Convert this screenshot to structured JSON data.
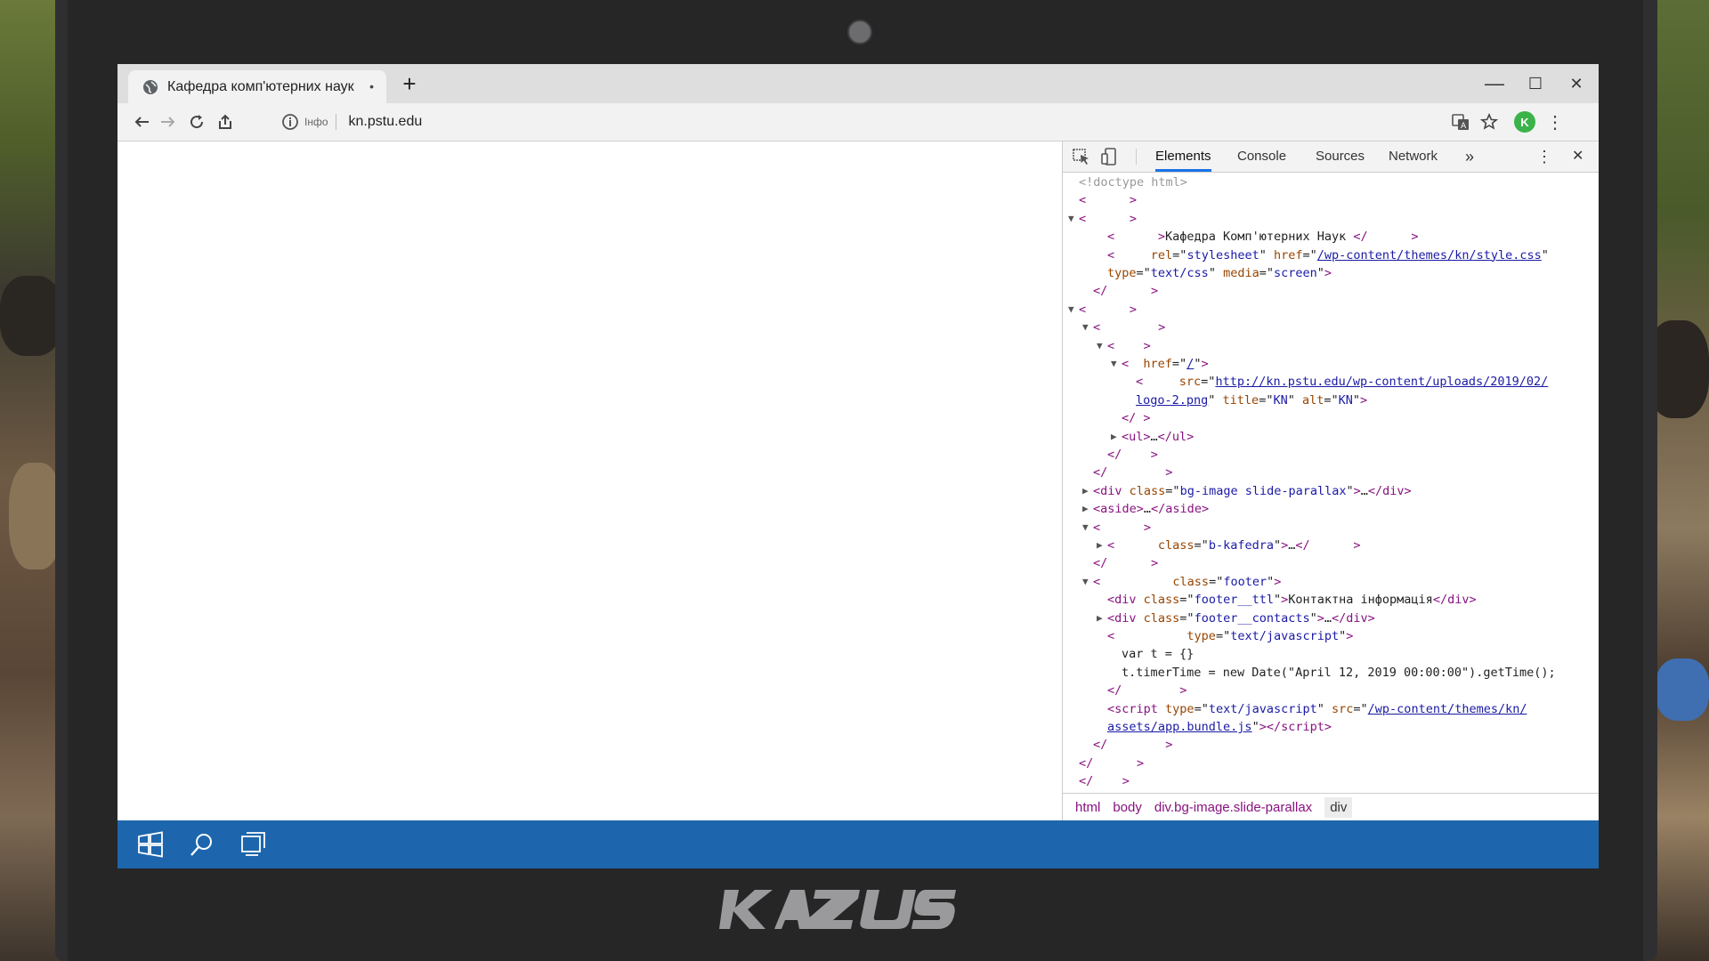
{
  "browser": {
    "tab_title": "Кафедра комп'ютерних наук",
    "tab_close": "•",
    "new_tab": "+",
    "url": "kn.pstu.edu",
    "security_label": "Інфо",
    "avatar_letter": "K",
    "accent_color": "#1a73e8"
  },
  "window_controls": {
    "minimize": "—",
    "maximize": "☐",
    "close": "✕"
  },
  "devtools": {
    "tabs": [
      "Elements",
      "Console",
      "Sources",
      "Network"
    ],
    "overflow": "»",
    "menu": "⋮",
    "close": "✕",
    "lines": [
      {
        "indent": 0,
        "tri": "",
        "html": "<span class='doctype'>&lt;!doctype html&gt;</span>"
      },
      {
        "indent": 0,
        "tri": "",
        "html": "<span class='tag'>&lt;      &gt;</span>"
      },
      {
        "indent": 0,
        "tri": "▼",
        "html": "<span class='tag'>&lt;      &gt;</span>"
      },
      {
        "indent": 2,
        "tri": "",
        "html": "<span class='tag'>&lt;      &gt;</span><span class='txt'>Кафедра Комп'ютерних Наук</span> <span class='tag'>&lt;/      &gt;</span>"
      },
      {
        "indent": 2,
        "tri": "",
        "html": "<span class='tag'>&lt;    </span> <span class='attr'>rel</span>=\"<span class='val'>stylesheet</span>\" <span class='attr'>href</span>=\"<span class='link'>/wp-content/themes/kn/style.css</span>\""
      },
      {
        "indent": 2,
        "tri": "",
        "html": "<span class='attr'>type</span>=\"<span class='val'>text/css</span>\" <span class='attr'>media</span>=\"<span class='val'>screen</span>\"<span class='tag'>&gt;</span>"
      },
      {
        "indent": 1,
        "tri": "",
        "html": "<span class='tag'>&lt;/      &gt;</span>"
      },
      {
        "indent": 0,
        "tri": "▼",
        "html": "<span class='tag'>&lt;      &gt;</span>"
      },
      {
        "indent": 1,
        "tri": "▼",
        "html": "<span class='tag'>&lt;        &gt;</span>"
      },
      {
        "indent": 2,
        "tri": "▼",
        "html": "<span class='tag'>&lt;    &gt;</span>"
      },
      {
        "indent": 3,
        "tri": "▼",
        "html": "<span class='tag'>&lt;</span>  <span class='attr'>href</span>=\"<span class='link'>/</span>\"<span class='tag'>&gt;</span>"
      },
      {
        "indent": 4,
        "tri": "",
        "html": "<span class='tag'>&lt;    </span> <span class='attr'>src</span>=\"<span class='link'>http://kn.pstu.edu/wp-content/uploads/2019/02/</span>"
      },
      {
        "indent": 4,
        "tri": "",
        "html": "<span class='link'>logo-2.png</span>\" <span class='attr'>title</span>=\"<span class='val'>KN</span>\" <span class='attr'>alt</span>=\"<span class='val'>KN</span>\"<span class='tag'>&gt;</span>"
      },
      {
        "indent": 3,
        "tri": "",
        "html": "<span class='tag'>&lt;/ &gt;</span>"
      },
      {
        "indent": 3,
        "tri": "▶",
        "html": "<span class='tag'>&lt;ul&gt;</span>…<span class='tag'>&lt;/ul&gt;</span>"
      },
      {
        "indent": 2,
        "tri": "",
        "html": "<span class='tag'>&lt;/    &gt;</span>"
      },
      {
        "indent": 1,
        "tri": "",
        "html": "<span class='tag'>&lt;/        &gt;</span>"
      },
      {
        "indent": 1,
        "tri": "▶",
        "html": "<span class='tag'>&lt;div</span> <span class='attr'>class</span>=\"<span class='val'>bg-image slide-parallax</span>\"<span class='tag'>&gt;</span>…<span class='tag'>&lt;/div&gt;</span>"
      },
      {
        "indent": 1,
        "tri": "▶",
        "html": "<span class='tag'>&lt;aside&gt;</span>…<span class='tag'>&lt;/aside&gt;</span>"
      },
      {
        "indent": 1,
        "tri": "▼",
        "html": "<span class='tag'>&lt;      &gt;</span>"
      },
      {
        "indent": 2,
        "tri": "▶",
        "html": "<span class='tag'>&lt;    </span>  <span class='attr'>class</span>=\"<span class='val'>b-kafedra</span>\"<span class='tag'>&gt;</span>…<span class='tag'>&lt;/      &gt;</span>"
      },
      {
        "indent": 1,
        "tri": "",
        "html": "<span class='tag'>&lt;/      &gt;</span>"
      },
      {
        "indent": 1,
        "tri": "▼",
        "html": "<span class='tag'>&lt;      </span>    <span class='attr'>class</span>=\"<span class='val'>footer</span>\"<span class='tag'>&gt;</span>"
      },
      {
        "indent": 2,
        "tri": "",
        "html": "<span class='tag'>&lt;div</span> <span class='attr'>class</span>=\"<span class='val'>footer__ttl</span>\"<span class='tag'>&gt;</span><span class='txt'>Контактна інформація</span><span class='tag'>&lt;/div&gt;</span>"
      },
      {
        "indent": 2,
        "tri": "▶",
        "html": "<span class='tag'>&lt;div</span> <span class='attr'>class</span>=\"<span class='val'>footer__contacts</span>\"<span class='tag'>&gt;</span>…<span class='tag'>&lt;/div&gt;</span>"
      },
      {
        "indent": 2,
        "tri": "",
        "html": "<span class='tag'>&lt;      </span>    <span class='attr'>type</span>=\"<span class='val'>text/javascript</span>\"<span class='tag'>&gt;</span>"
      },
      {
        "indent": 3,
        "tri": "",
        "html": "<span class='txt'>var t = {}</span>"
      },
      {
        "indent": 3,
        "tri": "",
        "html": "<span class='txt'>t.timerTime = new Date(\"April 12, 2019 00:00:00\").getTime();</span>"
      },
      {
        "indent": 2,
        "tri": "",
        "html": "<span class='tag'>&lt;/        &gt;</span>"
      },
      {
        "indent": 2,
        "tri": "",
        "html": "<span class='tag'>&lt;script</span> <span class='attr'>type</span>=\"<span class='val'>text/javascript</span>\" <span class='attr'>src</span>=\"<span class='link'>/wp-content/themes/kn/</span>"
      },
      {
        "indent": 2,
        "tri": "",
        "html": "<span class='link'>assets/app.bundle.js</span>\"<span class='tag'>&gt;&lt;/script&gt;</span>"
      },
      {
        "indent": 1,
        "tri": "",
        "html": "<span class='tag'>&lt;/        &gt;</span>"
      },
      {
        "indent": 0,
        "tri": "",
        "html": "<span class='tag'>&lt;/      &gt;</span>"
      },
      {
        "indent": 0,
        "tri": "",
        "html": "<span class='tag'>&lt;/    &gt;</span>"
      }
    ],
    "breadcrumbs": [
      "html",
      "body",
      "div.bg-image.slide-parallax",
      "div"
    ]
  },
  "taskbar": {
    "color": "#1d66ad",
    "icons": [
      "windows-start-icon",
      "search-icon",
      "task-view-icon"
    ]
  },
  "brand_logo": "KAZUS"
}
